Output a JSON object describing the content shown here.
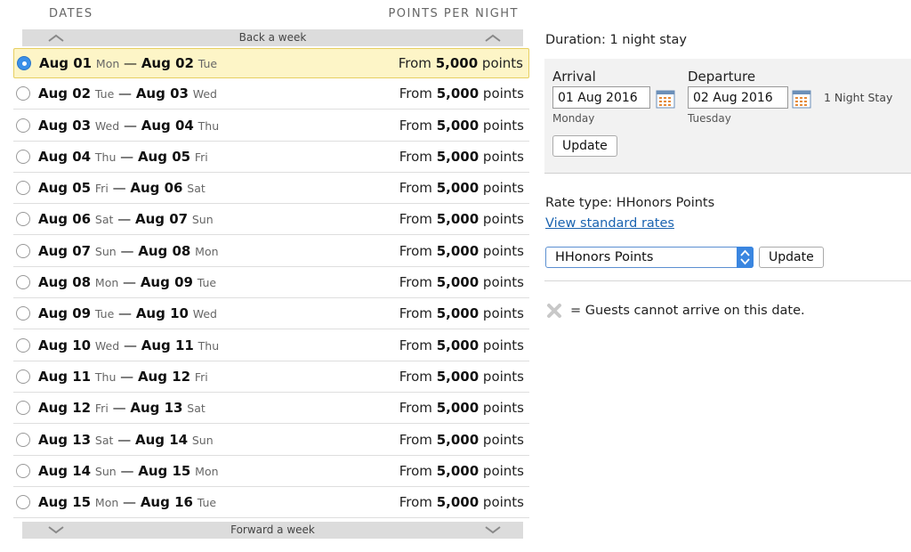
{
  "list": {
    "header_dates": "DATES",
    "header_points": "POINTS PER NIGHT",
    "back_label": "Back a week",
    "forward_label": "Forward a week",
    "rows": [
      {
        "from": "Aug 01",
        "from_dow": "Mon",
        "to": "Aug 02",
        "to_dow": "Tue",
        "prefix": "From",
        "points": "5,000",
        "suffix": "points",
        "selected": true
      },
      {
        "from": "Aug 02",
        "from_dow": "Tue",
        "to": "Aug 03",
        "to_dow": "Wed",
        "prefix": "From",
        "points": "5,000",
        "suffix": "points"
      },
      {
        "from": "Aug 03",
        "from_dow": "Wed",
        "to": "Aug 04",
        "to_dow": "Thu",
        "prefix": "From",
        "points": "5,000",
        "suffix": "points"
      },
      {
        "from": "Aug 04",
        "from_dow": "Thu",
        "to": "Aug 05",
        "to_dow": "Fri",
        "prefix": "From",
        "points": "5,000",
        "suffix": "points"
      },
      {
        "from": "Aug 05",
        "from_dow": "Fri",
        "to": "Aug 06",
        "to_dow": "Sat",
        "prefix": "From",
        "points": "5,000",
        "suffix": "points"
      },
      {
        "from": "Aug 06",
        "from_dow": "Sat",
        "to": "Aug 07",
        "to_dow": "Sun",
        "prefix": "From",
        "points": "5,000",
        "suffix": "points"
      },
      {
        "from": "Aug 07",
        "from_dow": "Sun",
        "to": "Aug 08",
        "to_dow": "Mon",
        "prefix": "From",
        "points": "5,000",
        "suffix": "points"
      },
      {
        "from": "Aug 08",
        "from_dow": "Mon",
        "to": "Aug 09",
        "to_dow": "Tue",
        "prefix": "From",
        "points": "5,000",
        "suffix": "points"
      },
      {
        "from": "Aug 09",
        "from_dow": "Tue",
        "to": "Aug 10",
        "to_dow": "Wed",
        "prefix": "From",
        "points": "5,000",
        "suffix": "points"
      },
      {
        "from": "Aug 10",
        "from_dow": "Wed",
        "to": "Aug 11",
        "to_dow": "Thu",
        "prefix": "From",
        "points": "5,000",
        "suffix": "points"
      },
      {
        "from": "Aug 11",
        "from_dow": "Thu",
        "to": "Aug 12",
        "to_dow": "Fri",
        "prefix": "From",
        "points": "5,000",
        "suffix": "points"
      },
      {
        "from": "Aug 12",
        "from_dow": "Fri",
        "to": "Aug 13",
        "to_dow": "Sat",
        "prefix": "From",
        "points": "5,000",
        "suffix": "points"
      },
      {
        "from": "Aug 13",
        "from_dow": "Sat",
        "to": "Aug 14",
        "to_dow": "Sun",
        "prefix": "From",
        "points": "5,000",
        "suffix": "points"
      },
      {
        "from": "Aug 14",
        "from_dow": "Sun",
        "to": "Aug 15",
        "to_dow": "Mon",
        "prefix": "From",
        "points": "5,000",
        "suffix": "points"
      },
      {
        "from": "Aug 15",
        "from_dow": "Mon",
        "to": "Aug 16",
        "to_dow": "Tue",
        "prefix": "From",
        "points": "5,000",
        "suffix": "points"
      }
    ],
    "separator": "—"
  },
  "stay": {
    "duration": "Duration: 1 night stay",
    "arrival_label": "Arrival",
    "arrival_value": "01 Aug 2016",
    "arrival_day": "Monday",
    "departure_label": "Departure",
    "departure_value": "02 Aug 2016",
    "departure_day": "Tuesday",
    "night_stay": "1 Night Stay",
    "update_label": "Update"
  },
  "rate": {
    "rate_type": "Rate type: HHonors Points",
    "view_standard": "View standard rates",
    "selected_option": "HHonors Points",
    "update_label": "Update"
  },
  "legend": {
    "text": "= Guests cannot arrive on this date."
  },
  "colors": {
    "selected_row_bg": "#fdf5c7",
    "selected_row_border": "#e6cf61",
    "radio_selected": "#3a8fe8",
    "link": "#1a63b0",
    "nav_bar": "#dcdcdc"
  },
  "icons": {
    "nav_up": "chevron-up-icon",
    "nav_down": "chevron-down-icon",
    "calendar": "calendar-icon",
    "unavailable": "x-mark-icon",
    "select_arrow": "updown-arrows-icon"
  }
}
